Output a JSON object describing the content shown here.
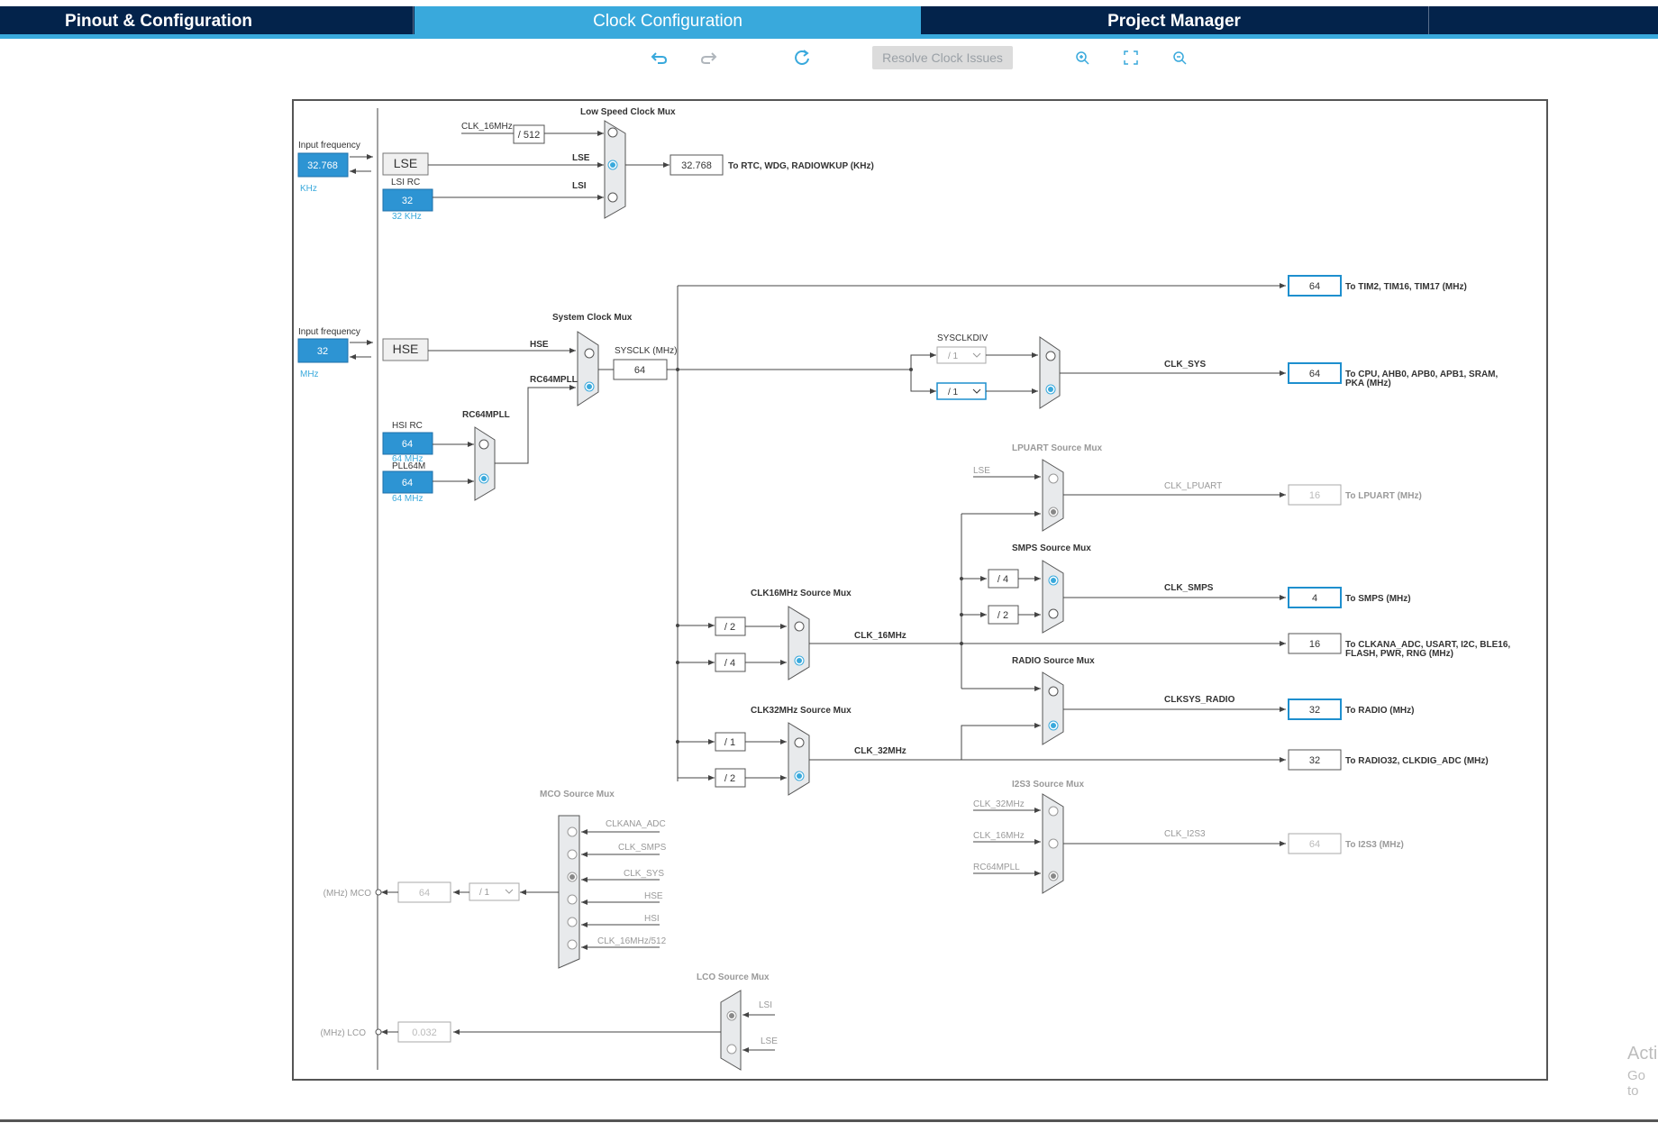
{
  "tabs": [
    {
      "label": "Pinout & Configuration"
    },
    {
      "label": "Clock Configuration"
    },
    {
      "label": "Project Manager"
    }
  ],
  "toolbar": {
    "resolve_label": "Resolve Clock Issues"
  },
  "watermark": {
    "line1": "Acti",
    "line2": "Go to"
  },
  "diagram": {
    "lse_input": {
      "title": "Input frequency",
      "value": "32.768",
      "unit": "KHz",
      "label": "LSE"
    },
    "lsi": {
      "title": "LSI RC",
      "value": "32",
      "unit": "32 KHz"
    },
    "hse_input": {
      "title": "Input frequency",
      "value": "32",
      "unit": "MHz",
      "label": "HSE"
    },
    "hsi": {
      "title": "HSI RC",
      "value": "64",
      "unit": "64 MHz"
    },
    "pll": {
      "title": "PLL64M",
      "value": "64",
      "unit": "64 MHz"
    },
    "low_speed_mux": {
      "title": "Low Speed Clock Mux",
      "in_clk16": "CLK_16MHz",
      "div": "/ 512",
      "in_lse": "LSE",
      "in_lsi": "LSI"
    },
    "rtc": {
      "value": "32.768",
      "label": "To RTC, WDG, RADIOWKUP (KHz)"
    },
    "system_mux": {
      "title": "System Clock Mux",
      "in_hse": "HSE",
      "in_pll": "RC64MPLL"
    },
    "rc64mpll": {
      "title": "RC64MPLL"
    },
    "sysclk": {
      "label": "SYSCLK (MHz)",
      "value": "64"
    },
    "tim": {
      "value": "64",
      "label": "To TIM2, TIM16, TIM17 (MHz)"
    },
    "sysclkdiv": {
      "title": "SYSCLKDIV",
      "opt1": "/ 1",
      "opt2": "/ 1"
    },
    "clk_sys": {
      "label": "CLK_SYS",
      "value": "64",
      "dest1": "To CPU, AHB0, APB0, APB1, SRAM,",
      "dest2": "PKA (MHz)"
    },
    "lpuart": {
      "title": "LPUART Source Mux",
      "in_lse": "LSE",
      "label": "CLK_LPUART",
      "value": "16",
      "dest": "To LPUART (MHz)"
    },
    "smps": {
      "title": "SMPS Source Mux",
      "div1": "/ 4",
      "div2": "/ 2",
      "label": "CLK_SMPS",
      "value": "4",
      "dest": "To SMPS (MHz)"
    },
    "clk16mux": {
      "title": "CLK16MHz Source Mux",
      "div1": "/ 2",
      "div2": "/ 4",
      "label": "CLK_16MHz"
    },
    "clk16out": {
      "value": "16",
      "dest1": "To CLKANA_ADC, USART, I2C, BLE16,",
      "dest2": "FLASH, PWR, RNG (MHz)"
    },
    "radio": {
      "title": "RADIO Source Mux",
      "label": "CLKSYS_RADIO",
      "value": "32",
      "dest": "To RADIO (MHz)"
    },
    "clk32mux": {
      "title": "CLK32MHz Source Mux",
      "div1": "/ 1",
      "div2": "/ 2",
      "label": "CLK_32MHz"
    },
    "clk32out": {
      "value": "32",
      "dest": "To RADIO32, CLKDIG_ADC (MHz)"
    },
    "i2s3": {
      "title": "I2S3 Source Mux",
      "in1": "CLK_32MHz",
      "in2": "CLK_16MHz",
      "in3": "RC64MPLL",
      "label": "CLK_I2S3",
      "value": "64",
      "dest": "To I2S3 (MHz)"
    },
    "mco": {
      "title": "MCO Source Mux",
      "in1": "CLKANA_ADC",
      "in2": "CLK_SMPS",
      "in3": "CLK_SYS",
      "in4": "HSE",
      "in5": "HSI",
      "in6": "CLK_16MHz/512",
      "div": "/ 1",
      "value": "64",
      "label": "(MHz) MCO"
    },
    "lco": {
      "title": "LCO Source Mux",
      "in1": "LSI",
      "in2": "LSE",
      "value": "0.032",
      "label": "(MHz) LCO"
    }
  },
  "colors": {
    "accent": "#39a9dc",
    "navy": "#03234b",
    "field_blue": "#2d94d3"
  }
}
